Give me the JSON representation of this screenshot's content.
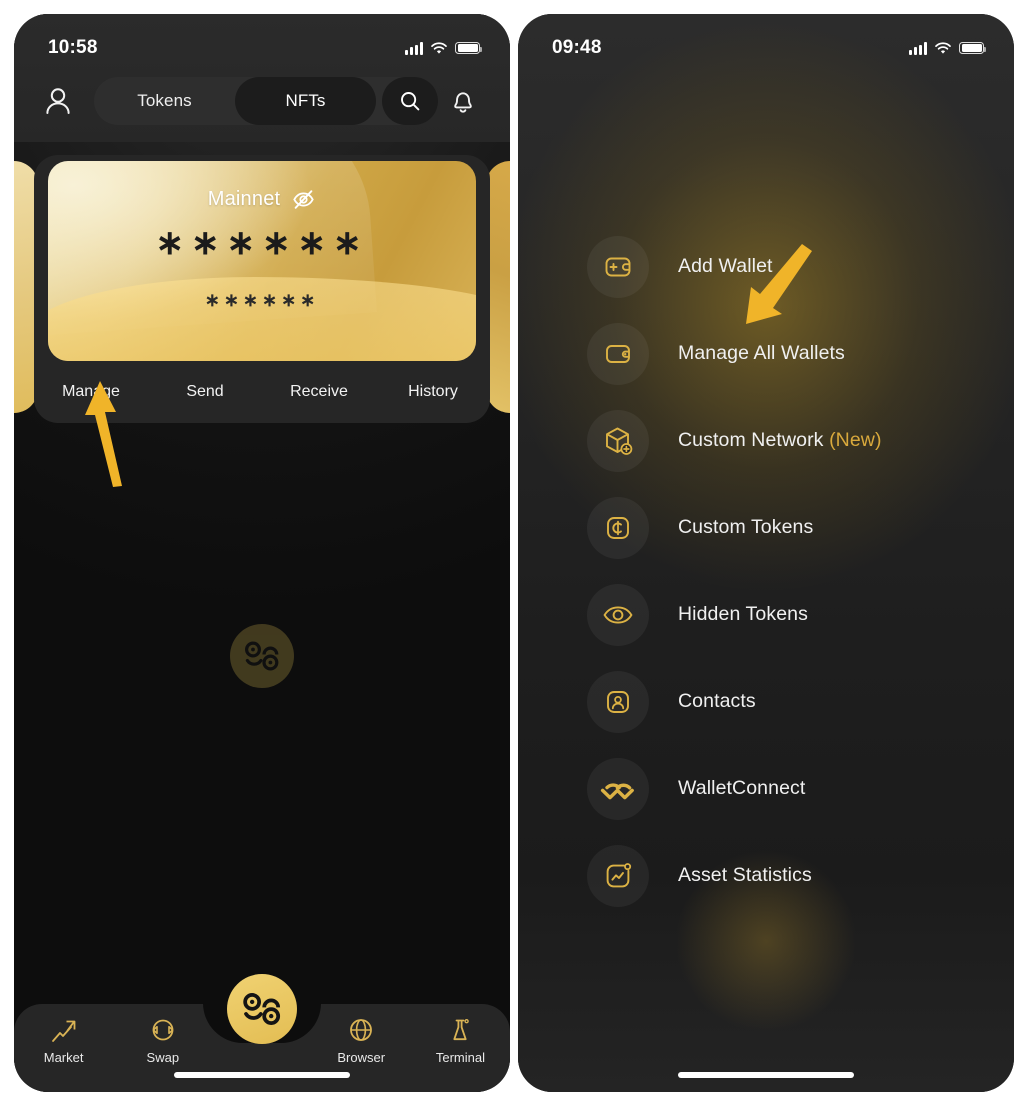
{
  "left_phone": {
    "status": {
      "time": "10:58",
      "signal_icon": "cellular-bars-icon",
      "wifi_icon": "wifi-icon",
      "battery_icon": "battery-full-icon"
    },
    "header": {
      "profile_icon": "person-icon",
      "tabs": [
        {
          "label": "Tokens",
          "active": false
        },
        {
          "label": "NFTs",
          "active": true
        }
      ],
      "search_icon": "search-icon",
      "notification_icon": "bell-icon"
    },
    "wallet_card": {
      "network": "Mainnet",
      "visibility_icon": "eye-off-icon",
      "balance_masked": "∗∗∗∗∗∗",
      "balance_sub_masked": "∗∗∗∗∗∗",
      "actions": [
        "Manage",
        "Send",
        "Receive",
        "History"
      ]
    },
    "watermark_logo": "app-logo-icon",
    "tabbar": {
      "items": [
        {
          "label": "Market",
          "icon": "pin-chart-icon"
        },
        {
          "label": "Swap",
          "icon": "swap-arrows-icon"
        },
        {
          "label": "Browser",
          "icon": "globe-icon"
        },
        {
          "label": "Terminal",
          "icon": "terminal-flask-icon"
        }
      ],
      "center_button_icon": "app-logo-icon"
    },
    "annotation_arrow": "arrow-pointing-to-manage"
  },
  "right_phone": {
    "status": {
      "time": "09:48",
      "signal_icon": "cellular-bars-icon",
      "wifi_icon": "wifi-icon",
      "battery_icon": "battery-full-icon"
    },
    "menu": [
      {
        "label": "Add Wallet",
        "badge": "",
        "icon": "wallet-add-icon"
      },
      {
        "label": "Manage All Wallets",
        "badge": "",
        "icon": "wallet-icon"
      },
      {
        "label": "Custom Network",
        "badge": "(New)",
        "icon": "cube-add-icon"
      },
      {
        "label": "Custom Tokens",
        "badge": "",
        "icon": "coin-square-icon"
      },
      {
        "label": "Hidden Tokens",
        "badge": "",
        "icon": "eye-icon"
      },
      {
        "label": "Contacts",
        "badge": "",
        "icon": "contact-card-icon"
      },
      {
        "label": "WalletConnect",
        "badge": "",
        "icon": "walletconnect-icon"
      },
      {
        "label": "Asset Statistics",
        "badge": "",
        "icon": "chart-square-icon"
      }
    ],
    "annotation_arrow": "arrow-pointing-to-manage-all-wallets"
  },
  "colors": {
    "gold": "#e0b949",
    "arrow": "#f0b429",
    "card_gold_light": "#efdda5",
    "card_gold_dark": "#c79c3c",
    "badge_new": "#d9a93c",
    "panel_dark": "#262626",
    "background": "#0d0d0d"
  }
}
